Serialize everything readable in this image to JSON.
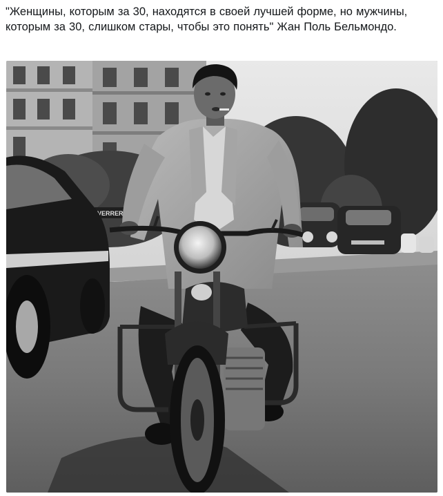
{
  "post": {
    "text": "\"Женщины, которым за 30, находятся в своей лучшей форме, но мужчины, которым за 30, слишком стары, чтобы это понять\" Жан Поль Бельмондо."
  },
  "photo": {
    "style": "black-and-white photograph",
    "sign_text": "VERRER"
  },
  "colors": {
    "text": "#14171a",
    "background": "#ffffff"
  }
}
